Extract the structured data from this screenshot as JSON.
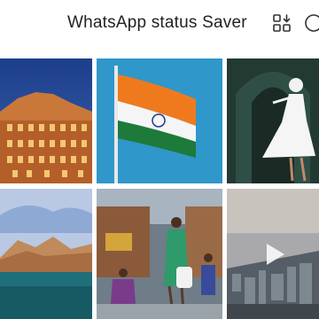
{
  "appbar": {
    "title": "WhatsApp status Saver",
    "actions": [
      {
        "name": "download-all-icon"
      },
      {
        "name": "more-icon"
      }
    ]
  },
  "media_grid": {
    "items": [
      {
        "kind": "image",
        "subject": "palace-at-dusk"
      },
      {
        "kind": "image",
        "subject": "flag-on-pole"
      },
      {
        "kind": "image",
        "subject": "dancer"
      },
      {
        "kind": "image",
        "subject": "mountain-lake"
      },
      {
        "kind": "image",
        "subject": "street-market"
      },
      {
        "kind": "video",
        "subject": "coastal-city"
      }
    ]
  }
}
